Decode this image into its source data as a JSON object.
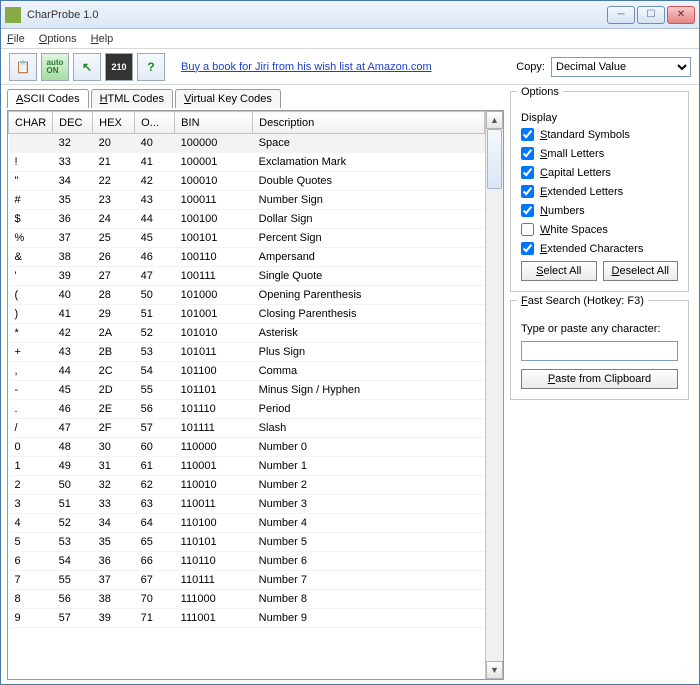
{
  "window": {
    "title": "CharProbe 1.0"
  },
  "menu": {
    "file": "File",
    "options": "Options",
    "help": "Help"
  },
  "toolbar": {
    "icons": {
      "clipboard": "📋",
      "auto": "auto\nON",
      "arrow": "↖",
      "digits": "210",
      "help": "?"
    },
    "link": "Buy a book for Jiri from his wish list at Amazon.com",
    "copy_label": "Copy:",
    "copy_value": "Decimal Value"
  },
  "tabs": {
    "ascii": "ASCII Codes",
    "html": "HTML Codes",
    "vkey": "Virtual Key Codes"
  },
  "columns": {
    "char": "CHAR",
    "dec": "DEC",
    "hex": "HEX",
    "oct": "O...",
    "bin": "BIN",
    "desc": "Description"
  },
  "rows": [
    {
      "ch": " ",
      "dec": "32",
      "hex": "20",
      "oct": "40",
      "bin": "100000",
      "desc": "Space"
    },
    {
      "ch": "!",
      "dec": "33",
      "hex": "21",
      "oct": "41",
      "bin": "100001",
      "desc": "Exclamation Mark"
    },
    {
      "ch": "\"",
      "dec": "34",
      "hex": "22",
      "oct": "42",
      "bin": "100010",
      "desc": "Double Quotes"
    },
    {
      "ch": "#",
      "dec": "35",
      "hex": "23",
      "oct": "43",
      "bin": "100011",
      "desc": "Number Sign"
    },
    {
      "ch": "$",
      "dec": "36",
      "hex": "24",
      "oct": "44",
      "bin": "100100",
      "desc": "Dollar Sign"
    },
    {
      "ch": "%",
      "dec": "37",
      "hex": "25",
      "oct": "45",
      "bin": "100101",
      "desc": "Percent Sign"
    },
    {
      "ch": "&",
      "dec": "38",
      "hex": "26",
      "oct": "46",
      "bin": "100110",
      "desc": "Ampersand"
    },
    {
      "ch": "'",
      "dec": "39",
      "hex": "27",
      "oct": "47",
      "bin": "100111",
      "desc": "Single Quote"
    },
    {
      "ch": "(",
      "dec": "40",
      "hex": "28",
      "oct": "50",
      "bin": "101000",
      "desc": "Opening Parenthesis"
    },
    {
      "ch": ")",
      "dec": "41",
      "hex": "29",
      "oct": "51",
      "bin": "101001",
      "desc": "Closing Parenthesis"
    },
    {
      "ch": "*",
      "dec": "42",
      "hex": "2A",
      "oct": "52",
      "bin": "101010",
      "desc": "Asterisk"
    },
    {
      "ch": "+",
      "dec": "43",
      "hex": "2B",
      "oct": "53",
      "bin": "101011",
      "desc": "Plus Sign"
    },
    {
      "ch": ",",
      "dec": "44",
      "hex": "2C",
      "oct": "54",
      "bin": "101100",
      "desc": "Comma"
    },
    {
      "ch": "-",
      "dec": "45",
      "hex": "2D",
      "oct": "55",
      "bin": "101101",
      "desc": "Minus Sign / Hyphen"
    },
    {
      "ch": ".",
      "dec": "46",
      "hex": "2E",
      "oct": "56",
      "bin": "101110",
      "desc": "Period"
    },
    {
      "ch": "/",
      "dec": "47",
      "hex": "2F",
      "oct": "57",
      "bin": "101111",
      "desc": "Slash"
    },
    {
      "ch": "0",
      "dec": "48",
      "hex": "30",
      "oct": "60",
      "bin": "110000",
      "desc": "Number 0"
    },
    {
      "ch": "1",
      "dec": "49",
      "hex": "31",
      "oct": "61",
      "bin": "110001",
      "desc": "Number 1"
    },
    {
      "ch": "2",
      "dec": "50",
      "hex": "32",
      "oct": "62",
      "bin": "110010",
      "desc": "Number 2"
    },
    {
      "ch": "3",
      "dec": "51",
      "hex": "33",
      "oct": "63",
      "bin": "110011",
      "desc": "Number 3"
    },
    {
      "ch": "4",
      "dec": "52",
      "hex": "34",
      "oct": "64",
      "bin": "110100",
      "desc": "Number 4"
    },
    {
      "ch": "5",
      "dec": "53",
      "hex": "35",
      "oct": "65",
      "bin": "110101",
      "desc": "Number 5"
    },
    {
      "ch": "6",
      "dec": "54",
      "hex": "36",
      "oct": "66",
      "bin": "110110",
      "desc": "Number 6"
    },
    {
      "ch": "7",
      "dec": "55",
      "hex": "37",
      "oct": "67",
      "bin": "110111",
      "desc": "Number 7"
    },
    {
      "ch": "8",
      "dec": "56",
      "hex": "38",
      "oct": "70",
      "bin": "111000",
      "desc": "Number 8"
    },
    {
      "ch": "9",
      "dec": "57",
      "hex": "39",
      "oct": "71",
      "bin": "111001",
      "desc": "Number 9"
    }
  ],
  "options": {
    "title": "Options",
    "display": "Display",
    "items": [
      {
        "label": "Standard Symbols",
        "checked": true
      },
      {
        "label": "Small Letters",
        "checked": true
      },
      {
        "label": "Capital Letters",
        "checked": true
      },
      {
        "label": "Extended Letters",
        "checked": true
      },
      {
        "label": "Numbers",
        "checked": true
      },
      {
        "label": "White Spaces",
        "checked": false
      },
      {
        "label": "Extended Characters",
        "checked": true
      }
    ],
    "select_all": "Select All",
    "deselect_all": "Deselect All"
  },
  "search": {
    "title": "Fast Search (Hotkey: F3)",
    "hint": "Type or paste any character:",
    "paste": "Paste from Clipboard"
  }
}
